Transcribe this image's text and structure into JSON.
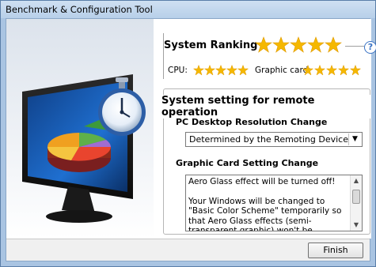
{
  "window": {
    "title": "Benchmark & Configuration Tool"
  },
  "ranking": {
    "title": "System Ranking",
    "overall_stars": 5,
    "cpu_label": "CPU:",
    "cpu_stars": 5,
    "gpu_label": "Graphic card:",
    "gpu_stars": 5,
    "help_glyph": "?"
  },
  "remote": {
    "title": "System setting for remote operation",
    "resolution_heading": "PC Desktop Resolution Change",
    "resolution_value": "Determined by the Remoting Device",
    "gpu_heading": "Graphic Card Setting Change",
    "gpu_text_1": "Aero Glass effect will be turned off!",
    "gpu_text_2": "Your Windows will be changed to \"Basic Color Scheme\" temporarily so that Aero Glass effects (semi-transparent graphic) won't be"
  },
  "footer": {
    "finish_label": "Finish"
  },
  "colors": {
    "star": "#f5b800",
    "accent": "#3a73c5"
  },
  "icons": {
    "help": "help-icon",
    "dropdown": "chevron-down-icon",
    "hero": "monitor-chart-stopwatch-illustration"
  }
}
